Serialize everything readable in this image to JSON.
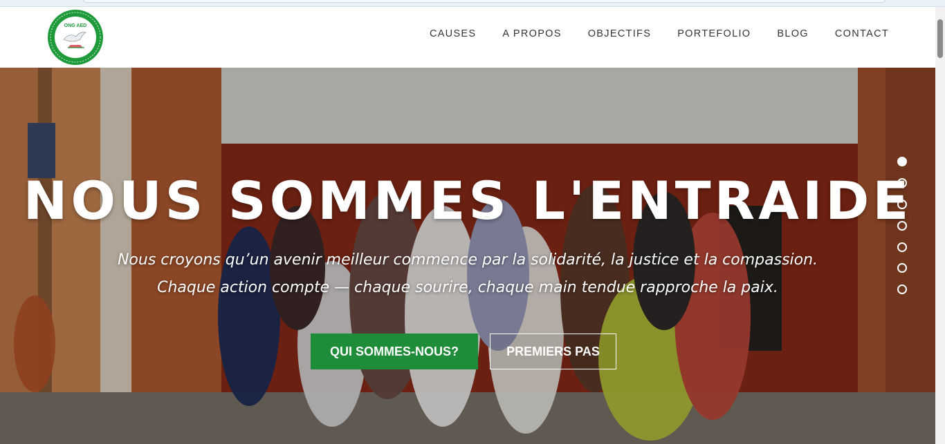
{
  "brand": {
    "logo_alt": "ONG AED - ONG Actions pour l'Entraide et le Développement"
  },
  "nav": {
    "items": [
      {
        "label": "CAUSES"
      },
      {
        "label": "A PROPOS"
      },
      {
        "label": "OBJECTIFS"
      },
      {
        "label": "PORTEFOLIO"
      },
      {
        "label": "BLOG"
      },
      {
        "label": "CONTACT"
      }
    ]
  },
  "hero": {
    "title": "NOUS SOMMES L'ENTRAIDE",
    "subtitle_line1": "Nous croyons qu’un avenir meilleur commence par la solidarité, la justice et la compassion.",
    "subtitle_line2": "Chaque action compte — chaque sourire, chaque main tendue rapproche la paix.",
    "primary_button": "QUI SOMMES-NOUS?",
    "secondary_button": "PREMIERS PAS"
  },
  "slider": {
    "total": 7,
    "active": 1
  },
  "colors": {
    "accent": "#1f8c3a",
    "text_dark": "#333333",
    "white": "#ffffff"
  }
}
